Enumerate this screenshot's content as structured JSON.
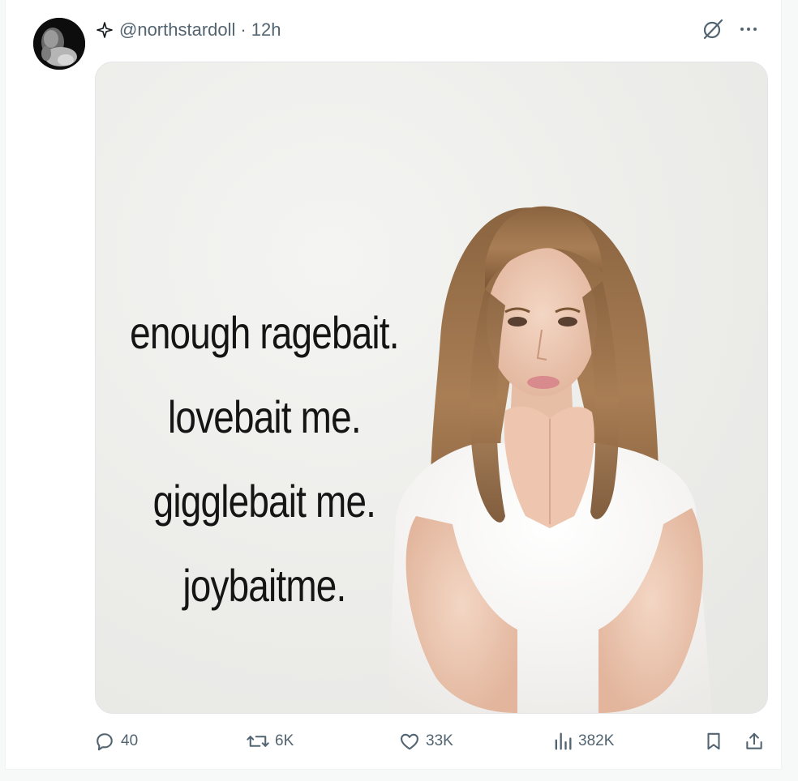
{
  "post": {
    "handle": "@northstardoll",
    "separator": "·",
    "time": "12h",
    "image_caption": [
      "enough ragebait.",
      "lovebait me.",
      "gigglebait me.",
      "joybaitme."
    ]
  },
  "icons": {
    "header": [
      "sparkle-icon",
      "grok-icon",
      "more-icon"
    ],
    "actions": [
      "reply-icon",
      "repost-icon",
      "like-icon",
      "views-icon",
      "bookmark-icon",
      "share-icon"
    ]
  },
  "actions": {
    "replies": "40",
    "reposts": "6K",
    "likes": "33K",
    "views": "382K"
  },
  "colors": {
    "secondary_text": "#536471",
    "media_background": "#eeeeec",
    "caption_text": "#151515"
  }
}
